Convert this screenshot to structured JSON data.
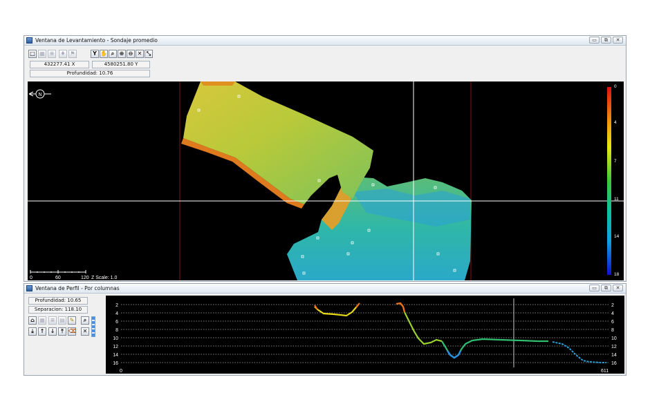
{
  "survey_window": {
    "title": "Ventana de Levantamiento - Sondaje promedio",
    "coord_x": "432277.41 X",
    "coord_y": "4580251.80 Y",
    "depth": "Profundidad: 10.76",
    "north_label": "N",
    "scale_ticks": [
      "0",
      "60",
      "120"
    ],
    "z_scale": "Z Scale: 1.0",
    "colorbar_ticks": [
      "0",
      "4",
      "7",
      "11",
      "14",
      "18"
    ],
    "toolbar_glyphs": [
      "⌂",
      "✋",
      "⊕",
      "⊖",
      "✕",
      "⤡"
    ]
  },
  "profile_window": {
    "title": "Ventana de Perfil - Por columnas",
    "depth": "Profundidad: 10.65",
    "separation": "Separacion: 118.10",
    "left_ticks": [
      "2",
      "4",
      "6",
      "8",
      "10",
      "12",
      "14",
      "16"
    ],
    "right_ticks": [
      "2",
      "4",
      "6",
      "8",
      "10",
      "12",
      "14",
      "16"
    ],
    "x_start": "0",
    "x_end": "611"
  },
  "window_buttons": {
    "minimize": "▭",
    "restore": "⧉",
    "close": "✕"
  },
  "colors": {
    "map_bg": "#000000",
    "crosshair": "#ffffff",
    "redline": "#7a1a1a",
    "window_bg": "#f0f0f0"
  }
}
